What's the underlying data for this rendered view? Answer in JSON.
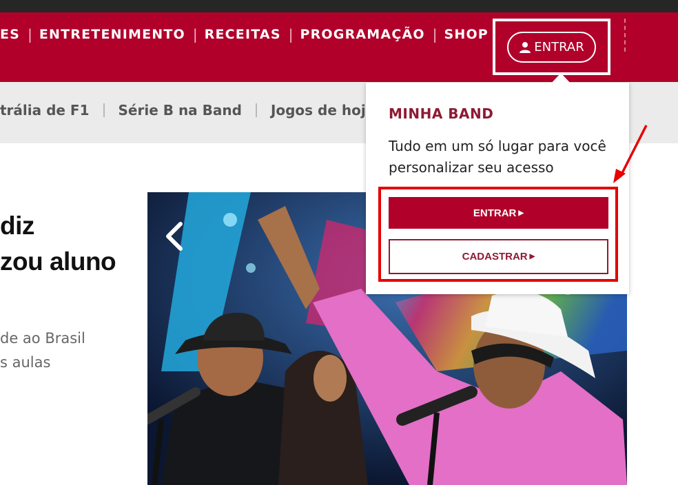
{
  "header": {
    "nav_items": [
      "ES",
      "ENTRETENIMENTO",
      "RECEITAS",
      "PROGRAMAÇÃO",
      "SHOP"
    ],
    "login_label": "ENTRAR",
    "login_icon": "user-icon",
    "brand_color": "#b1002a"
  },
  "subnav": {
    "items": [
      "trália de F1",
      "Série B na Band",
      "Jogos de hoje"
    ]
  },
  "article": {
    "headline_lines": [
      "diz",
      "zou aluno"
    ],
    "summary_lines": [
      "de ao Brasil",
      "s aulas"
    ]
  },
  "carousel": {
    "prev_icon": "chevron-left-icon",
    "next_icon": "chevron-right-icon"
  },
  "login_popup": {
    "title": "MINHA BAND",
    "description": "Tudo em um só lugar para você personalizar seu acesso",
    "login_button": "ENTRAR",
    "signup_button": "CADASTRAR",
    "highlight_color": "#e60000"
  }
}
